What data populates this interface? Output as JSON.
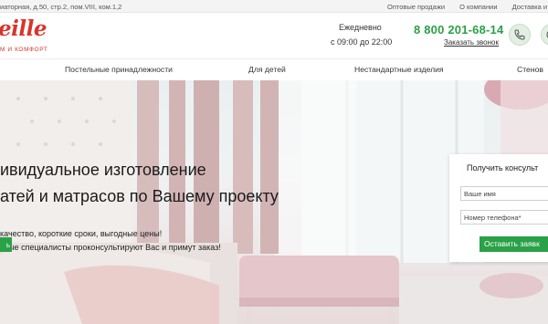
{
  "topbar": {
    "address": "иаторная, д.50, стр.2, пом.VIII, ком.1,2",
    "links": [
      "Оптовые продажи",
      "О компании",
      "Доставка и оплата"
    ]
  },
  "header": {
    "logo_text": "eille",
    "logo_sub": "М И КОМФОРТ",
    "schedule_label": "Ежедневно",
    "schedule_hours": "с 09:00 до 22:00",
    "phone": "8 800 201-68-14",
    "callback_label": "Заказать звонок",
    "icons": [
      "phone-icon",
      "whatsapp-icon"
    ]
  },
  "nav": {
    "items": [
      "Постельные принадлежности",
      "Для детей",
      "Нестандартные изделия",
      "Стенов"
    ]
  },
  "hero": {
    "title_line1": "ивидуальное изготовление",
    "title_line2": "атей и матрасов по Вашему проекту",
    "sub_line1": "качество, короткие сроки, выгодные цены!",
    "sub_line2": "тные специалисты проконсультируют Вас и примут заказ!",
    "button_label": "ь"
  },
  "form": {
    "title": "Получить консульт",
    "name_placeholder": "Ваше имя",
    "phone_placeholder": "Номер телефона*",
    "submit_label": "Оставить заявк"
  },
  "colors": {
    "accent_green": "#2aa147",
    "logo_red": "#d9352b"
  }
}
